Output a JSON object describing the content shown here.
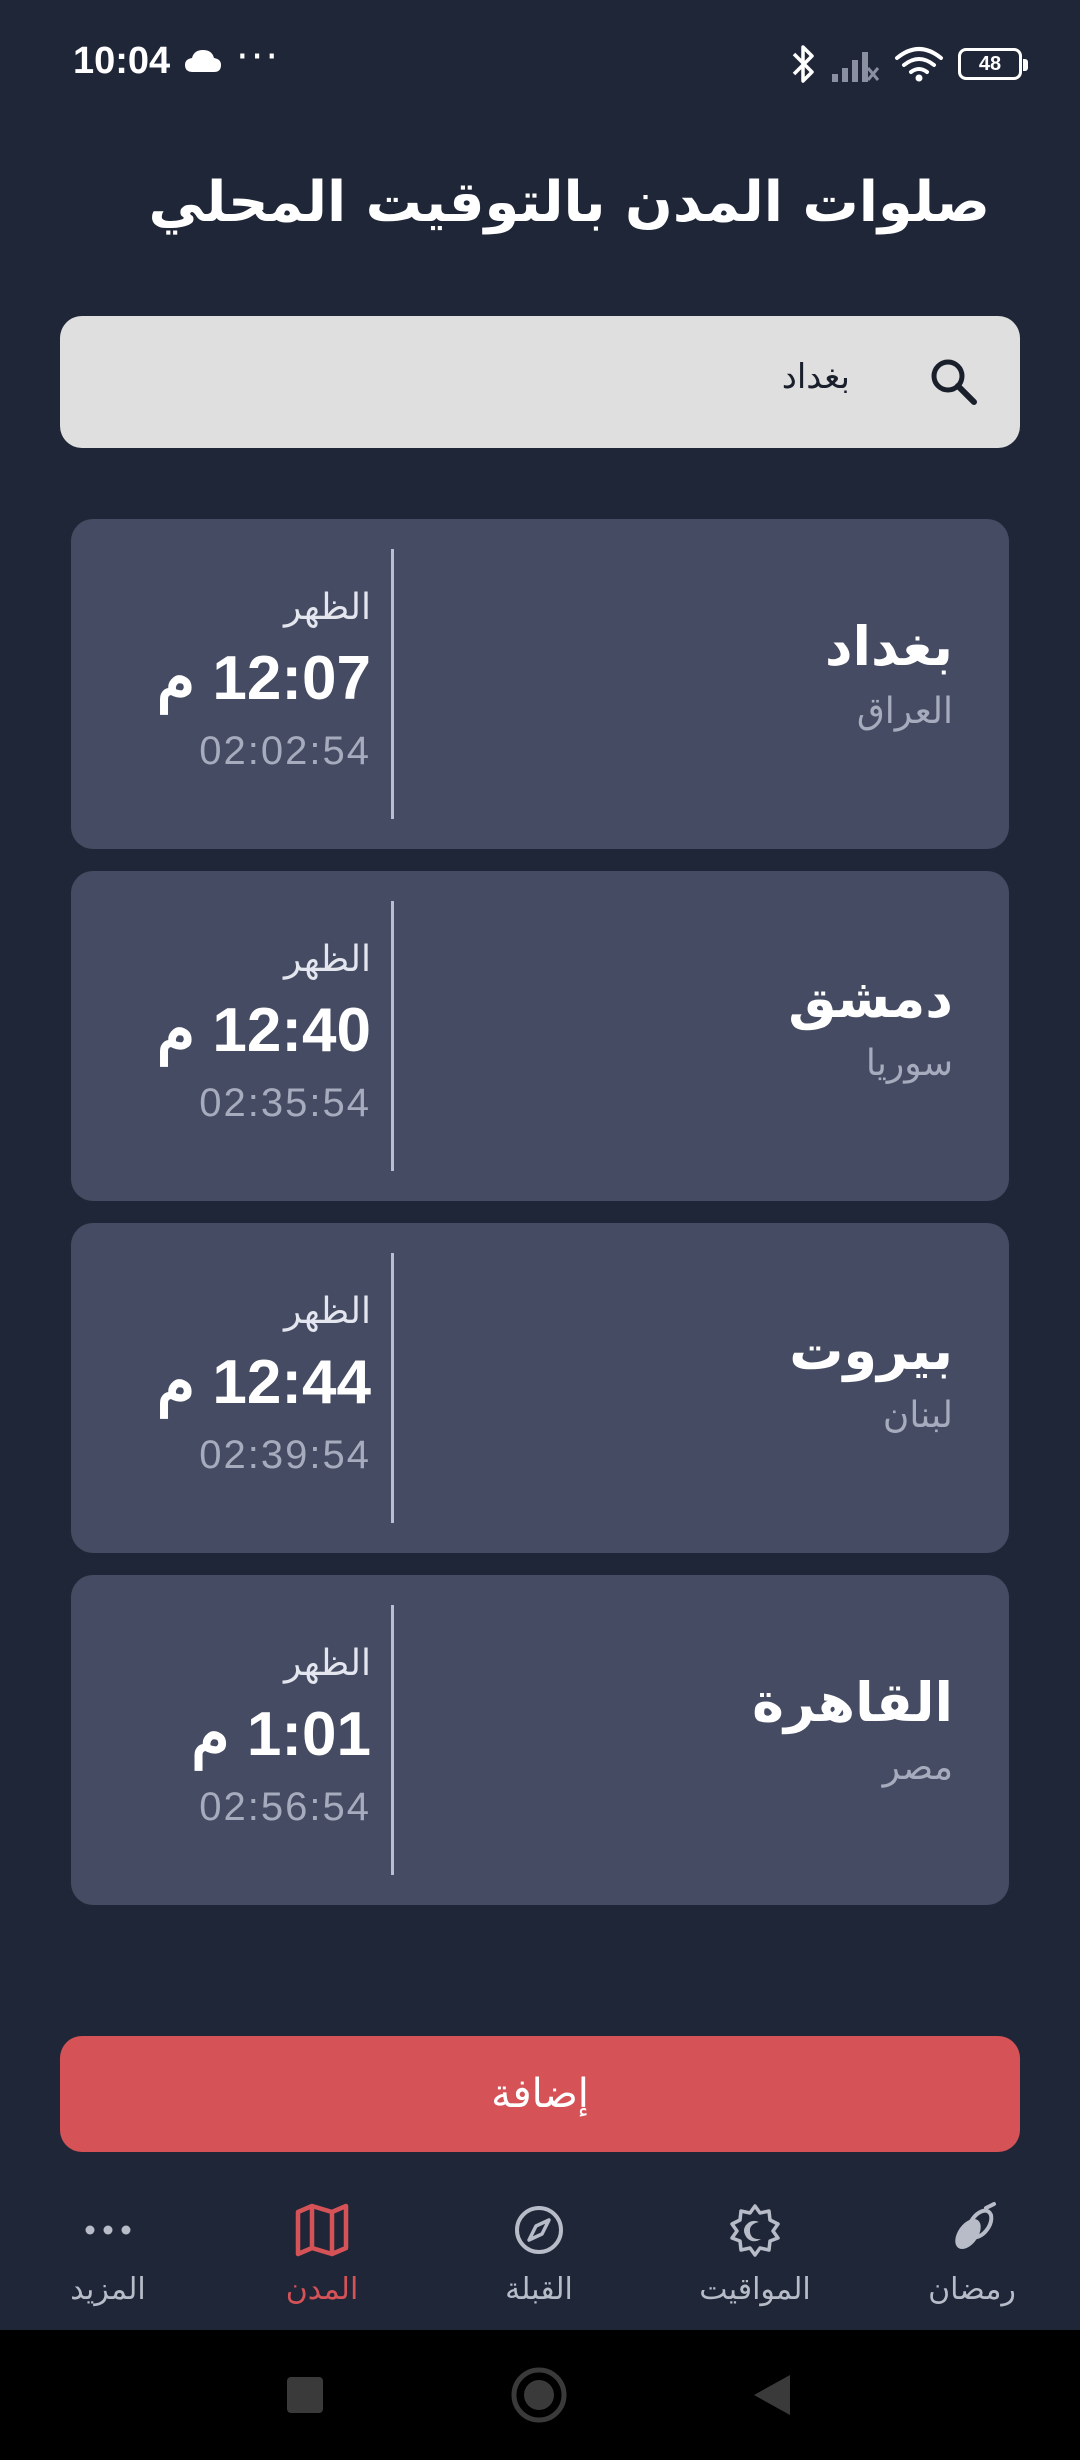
{
  "status_bar": {
    "time": "10:04",
    "battery": "48",
    "icons": [
      "cloud-icon",
      "more-dots-icon",
      "bluetooth-icon",
      "signal-icon",
      "wifi-icon",
      "battery-icon"
    ]
  },
  "header": {
    "title": "صلوات المدن بالتوقيت المحلي"
  },
  "search": {
    "value": "بغداد",
    "icon": "search-icon"
  },
  "cities": [
    {
      "name": "بغداد",
      "country": "العراق",
      "prayer": "الظهر",
      "time": "12:07 م",
      "countdown": "02:02:54"
    },
    {
      "name": "دمشق",
      "country": "سوريا",
      "prayer": "الظهر",
      "time": "12:40 م",
      "countdown": "02:35:54"
    },
    {
      "name": "بيروت",
      "country": "لبنان",
      "prayer": "الظهر",
      "time": "12:44 م",
      "countdown": "02:39:54"
    },
    {
      "name": "القاهرة",
      "country": "مصر",
      "prayer": "الظهر",
      "time": "1:01 م",
      "countdown": "02:56:54"
    }
  ],
  "add_button": {
    "label": "إضافة"
  },
  "bottom_nav": {
    "items": [
      {
        "label": "المزيد",
        "icon": "more-dots-icon",
        "active": false
      },
      {
        "label": "المدن",
        "icon": "map-icon",
        "active": true
      },
      {
        "label": "القبلة",
        "icon": "compass-icon",
        "active": false
      },
      {
        "label": "المواقيت",
        "icon": "crescent-gear-icon",
        "active": false
      },
      {
        "label": "رمضان",
        "icon": "dates-icon",
        "active": false
      }
    ]
  },
  "colors": {
    "background": "#1f2637",
    "card": "#454b62",
    "accent": "#d55257",
    "search_bg": "#dfdfdf",
    "muted_text": "#a6abbd"
  }
}
